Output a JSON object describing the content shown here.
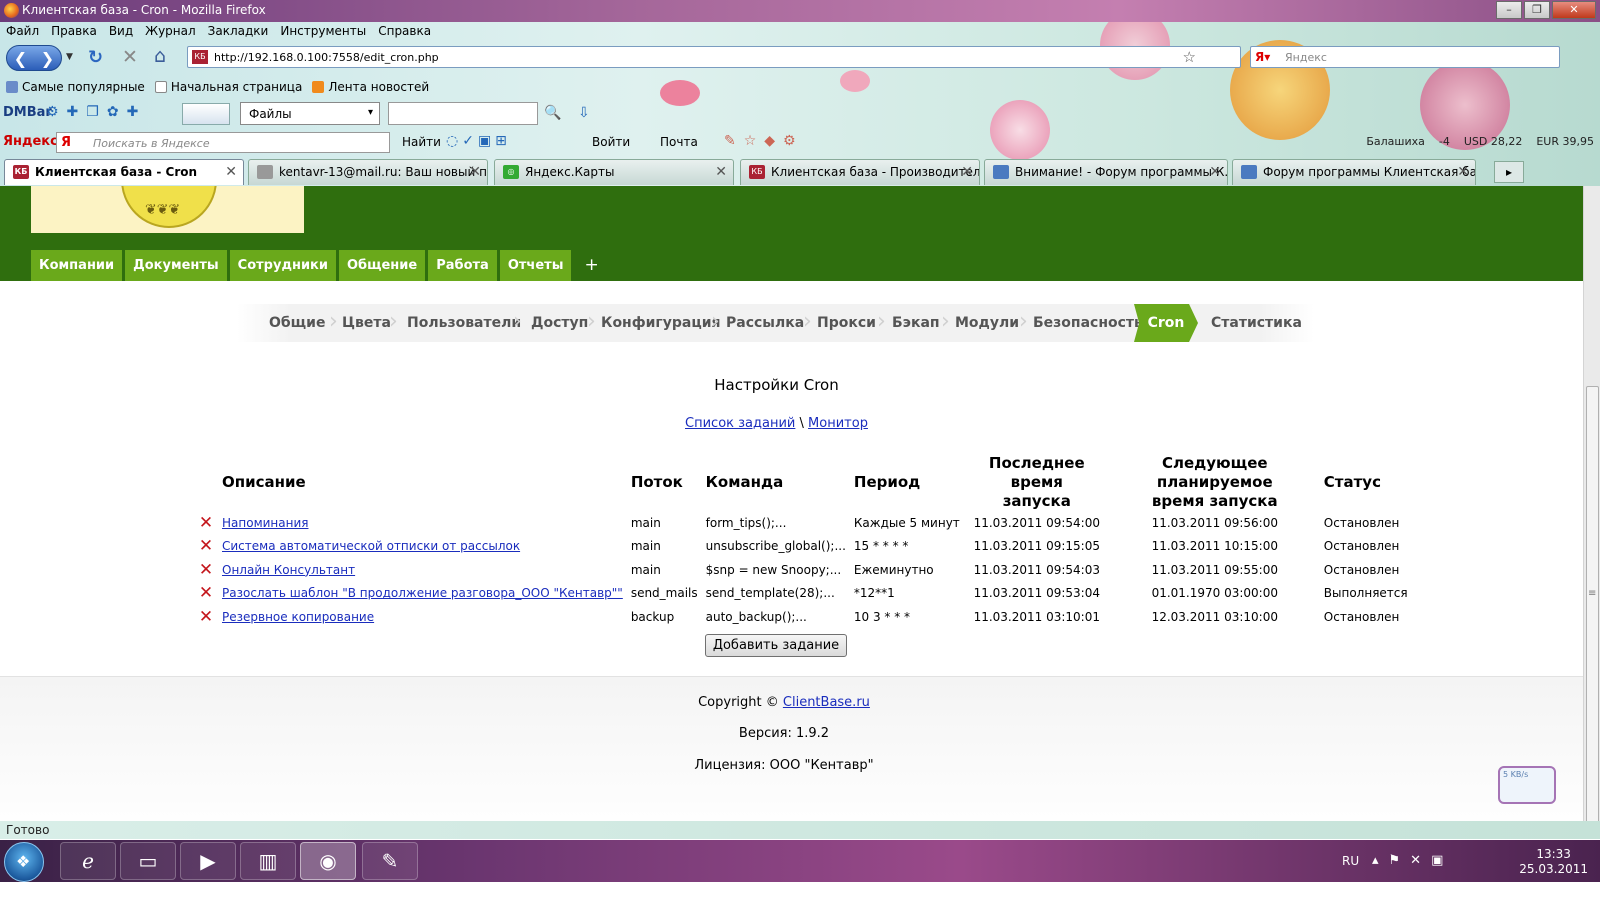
{
  "browser": {
    "window_title": "Клиентская база - Cron - Mozilla Firefox",
    "menu": [
      "Файл",
      "Правка",
      "Вид",
      "Журнал",
      "Закладки",
      "Инструменты",
      "Справка"
    ],
    "url": "http://192.168.0.100:7558/edit_cron.php",
    "search_placeholder": "Яндекс",
    "bookmarks": [
      "Самые популярные",
      "Начальная страница",
      "Лента новостей"
    ],
    "dmbar": {
      "label": "DMBar",
      "select_value": "Файлы"
    },
    "yandex_bar": {
      "label": "Яндекс",
      "search_placeholder": "Поискать в Яндексе",
      "find": "Найти",
      "login": "Войти",
      "mail": "Почта",
      "city": "Балашиха",
      "temp": "-4",
      "usd": "USD 28,22",
      "eur": "EUR 39,95"
    },
    "tabs": [
      {
        "label": "Клиентская база - Cron",
        "active": true
      },
      {
        "label": "kentavr-13@mail.ru: Ваш новый па...",
        "active": false
      },
      {
        "label": "Яндекс.Карты",
        "active": false
      },
      {
        "label": "Клиентская база - Производитель...",
        "active": false
      },
      {
        "label": "Внимание! - Форум программы К...",
        "active": false
      },
      {
        "label": "Форум программы Клиентская ба...",
        "active": false
      }
    ],
    "status": "Готово"
  },
  "app": {
    "main_nav": [
      "Компании",
      "Документы",
      "Сотрудники",
      "Общение",
      "Работа",
      "Отчеты",
      "+"
    ],
    "settings_nav": [
      "Общие",
      "Цвета",
      "Пользователи",
      "Доступ",
      "Конфигурация",
      "Рассылка",
      "Прокси",
      "Бэкап",
      "Модули",
      "Безопасность",
      "Cron",
      "Статистика"
    ],
    "settings_active": "Cron",
    "page_title": "Настройки Cron",
    "link_tasks": "Список заданий",
    "link_sep": "\\",
    "link_monitor": "Монитор",
    "table": {
      "headers": {
        "description": "Описание",
        "thread": "Поток",
        "command": "Команда",
        "period": "Период",
        "last_run_1": "Последнее время",
        "last_run_2": "запуска",
        "next_run_1": "Следующее планируемое",
        "next_run_2": "время запуска",
        "status": "Статус"
      },
      "rows": [
        {
          "description": "Напоминания",
          "thread": "main",
          "command": "form_tips();...",
          "period": "Каждые 5 минут",
          "last_run": "11.03.2011 09:54:00",
          "next_run": "11.03.2011 09:56:00",
          "status": "Остановлен"
        },
        {
          "description": "Система автоматической отписки от рассылок",
          "thread": "main",
          "command": "unsubscribe_global();...",
          "period": "15 * * * *",
          "last_run": "11.03.2011 09:15:05",
          "next_run": "11.03.2011 10:15:00",
          "status": "Остановлен"
        },
        {
          "description": "Онлайн Консультант",
          "thread": "main",
          "command": "$snp = new Snoopy;...",
          "period": "Ежеминутно",
          "last_run": "11.03.2011 09:54:03",
          "next_run": "11.03.2011 09:55:00",
          "status": "Остановлен"
        },
        {
          "description": "Разослать шаблон \"В продолжение разговора_ООО \"Кентавр\"\"",
          "thread": "send_mails",
          "command": "send_template(28);...",
          "period": "*12**1",
          "last_run": "11.03.2011 09:53:04",
          "next_run": "01.01.1970 03:00:00",
          "status": "Выполняется"
        },
        {
          "description": "Резервное копирование",
          "thread": "backup",
          "command": "auto_backup();...",
          "period": "10 3 * * *",
          "last_run": "11.03.2011 03:10:01",
          "next_run": "12.03.2011 03:10:00",
          "status": "Остановлен"
        }
      ]
    },
    "add_button": "Добавить задание",
    "footer": {
      "copyright_prefix": "Copyright ©",
      "copyright_link": "ClientBase.ru",
      "version": "Версия: 1.9.2",
      "license": "Лицензия: ООО \"Кентавр\""
    },
    "speed_widget": "5 KB/s"
  },
  "taskbar": {
    "lang": "RU",
    "time": "13:33",
    "date": "25.03.2011"
  },
  "colors": {
    "green_dark": "#2f6e0e",
    "green_accent": "#6aa91b",
    "link": "#1a2dbd",
    "delete": "#c4161c"
  }
}
